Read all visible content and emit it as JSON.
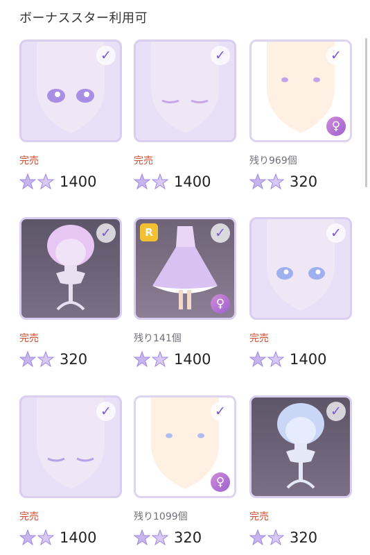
{
  "header": {
    "title": "ボーナススター利用可"
  },
  "cards": [
    {
      "status": "完売",
      "price": "1400",
      "kind": "face-eyes"
    },
    {
      "status": "完売",
      "price": "1400",
      "kind": "face-closed"
    },
    {
      "status": "残り969個",
      "price": "320",
      "kind": "face-dots"
    },
    {
      "status": "完売",
      "price": "320",
      "kind": "hair-pink"
    },
    {
      "status": "残り141個",
      "price": "1400",
      "kind": "dress",
      "rarity": "R"
    },
    {
      "status": "完売",
      "price": "1400",
      "kind": "face-blue-eyes"
    },
    {
      "status": "完売",
      "price": "1400",
      "kind": "face-closed-2"
    },
    {
      "status": "残り1099個",
      "price": "320",
      "kind": "face-blue-dots"
    },
    {
      "status": "完売",
      "price": "320",
      "kind": "hair-blue"
    }
  ],
  "icons": {
    "check": "check-icon",
    "female": "female-icon",
    "star": "bonus-star-icon"
  },
  "colors": {
    "accent": "#7a55d6",
    "soldout": "#cc4f35",
    "remain": "#6f6f7a"
  }
}
